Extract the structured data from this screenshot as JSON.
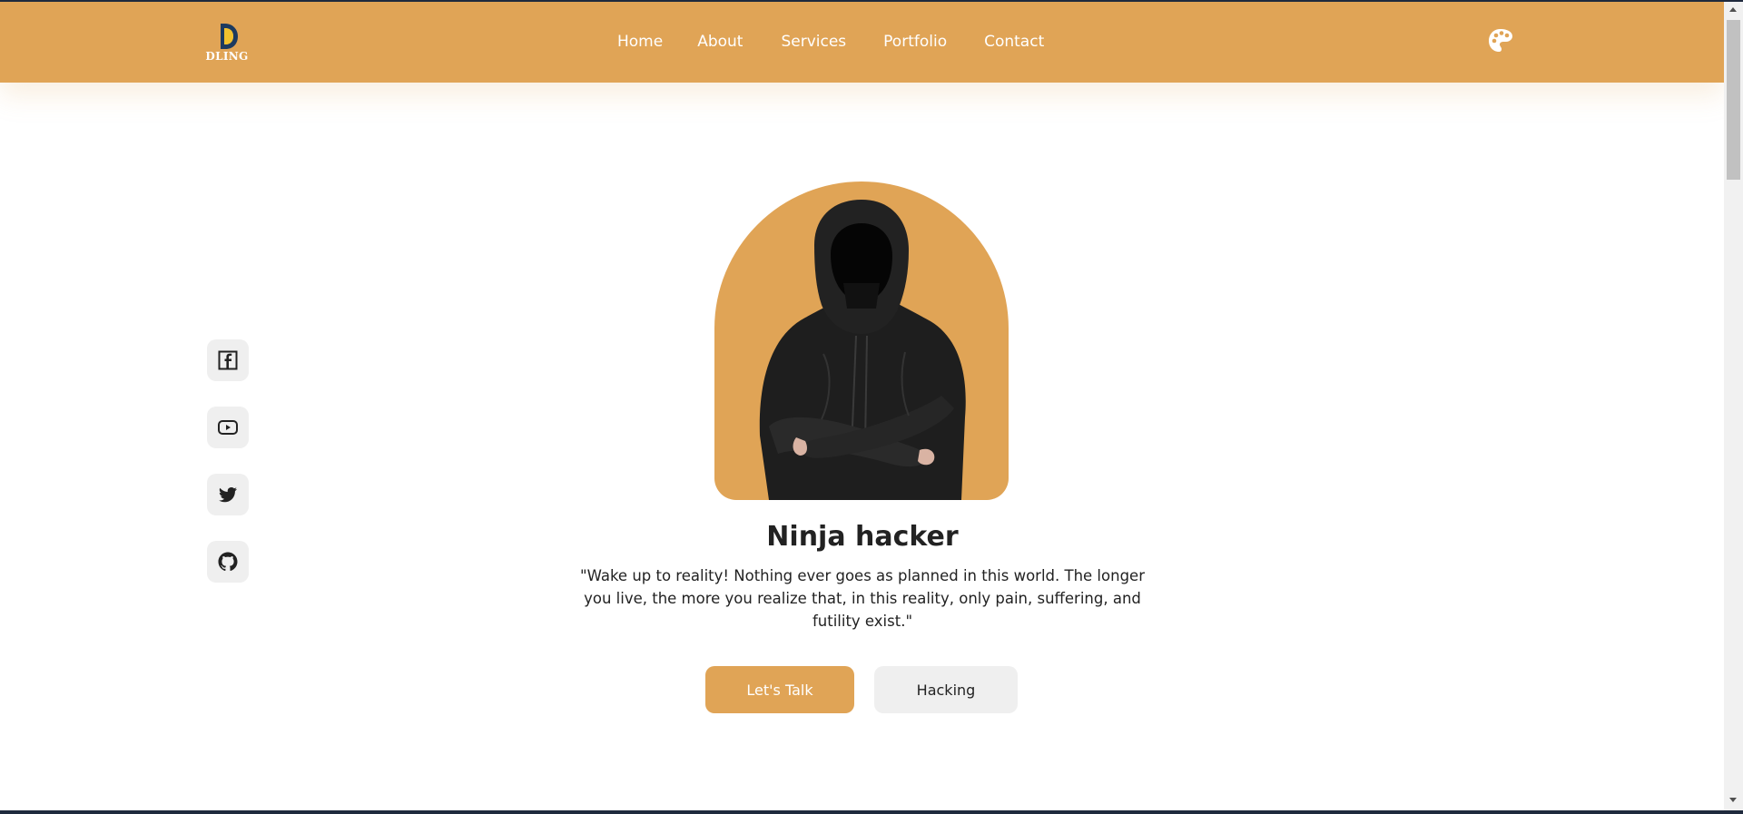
{
  "colors": {
    "accent": "#e0a456",
    "text": "#222222",
    "light_button": "#efefef",
    "border_dark": "#1f2a3d"
  },
  "header": {
    "logo_text": "DLING",
    "nav": [
      "Home",
      "About",
      "Services",
      "Portfolio",
      "Contact"
    ],
    "theme_icon": "palette-icon"
  },
  "social": {
    "icons": [
      "facebook-icon",
      "youtube-icon",
      "twitter-icon",
      "github-icon"
    ]
  },
  "hero": {
    "image": "hooded-figure-portrait",
    "title": "Ninja hacker",
    "quote": "\"Wake up to reality! Nothing ever goes as planned in this world. The longer you live, the more you realize that, in this reality, only pain, suffering, and futility exist.\"",
    "primary_button": "Let's Talk",
    "secondary_button": "Hacking"
  }
}
